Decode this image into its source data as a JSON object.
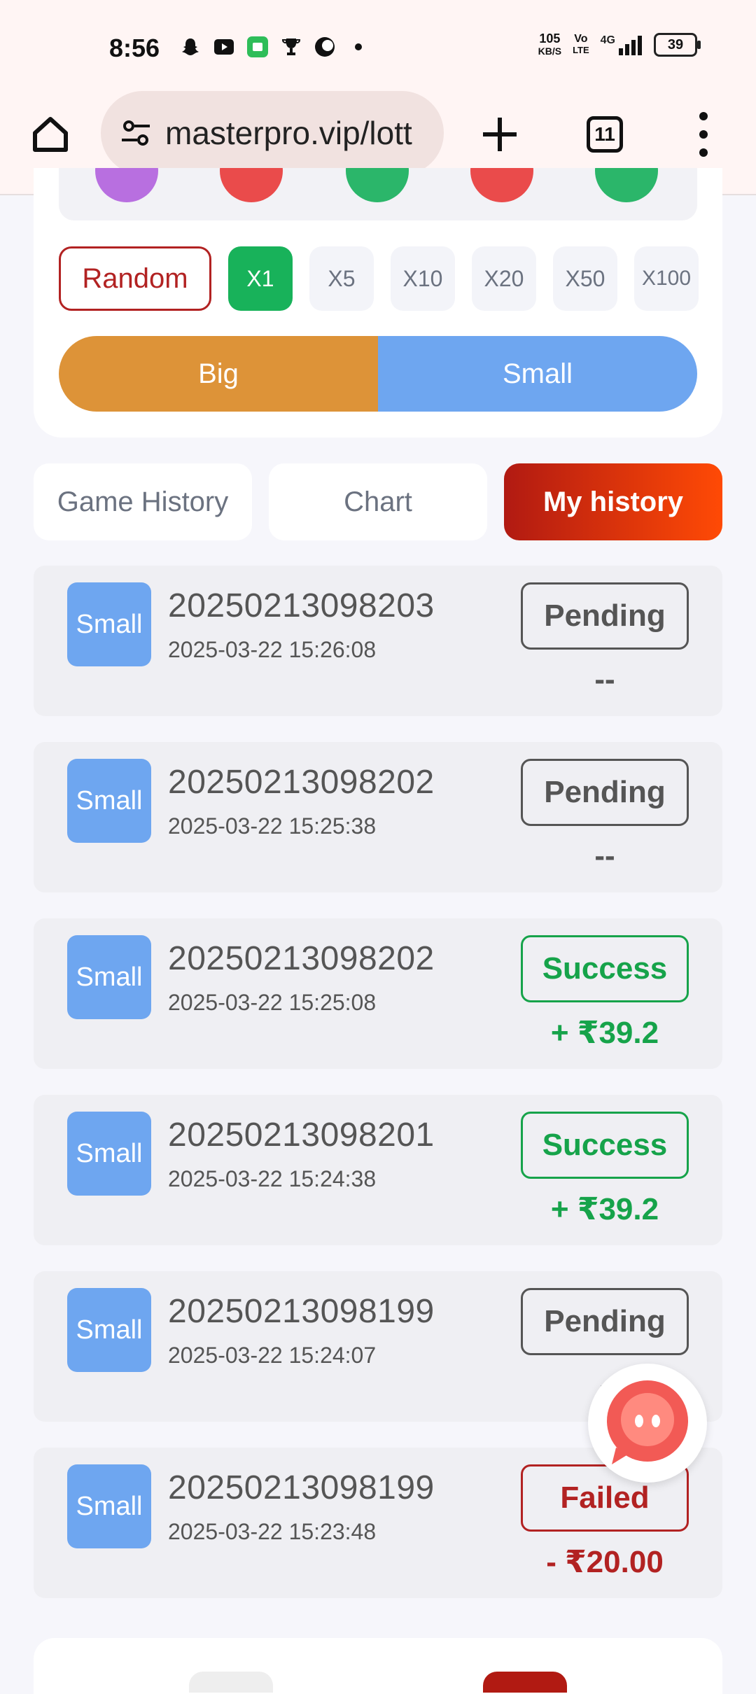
{
  "status_bar": {
    "time": "8:56",
    "net_speed_value": "105",
    "net_speed_unit": "KB/S",
    "volte_top": "Vo",
    "volte_bottom": "LTE",
    "network": "4G",
    "battery": "39"
  },
  "browser": {
    "url": "masterpro.vip/lott",
    "tab_count": "11"
  },
  "bet_panel": {
    "random_label": "Random",
    "multipliers": [
      "X1",
      "X5",
      "X10",
      "X20",
      "X50",
      "X100"
    ],
    "active_multiplier": "X1",
    "big_label": "Big",
    "small_label": "Small",
    "colors": {
      "big": "#dd9338",
      "small": "#6ea6f0",
      "active_mult": "#18b25a"
    }
  },
  "tabs": {
    "game_history": "Game History",
    "chart": "Chart",
    "my_history": "My history",
    "active": "My history"
  },
  "history": [
    {
      "bet": "Small",
      "period": "20250213098203",
      "time": "2025-03-22 15:26:08",
      "status": "Pending",
      "amount": "--"
    },
    {
      "bet": "Small",
      "period": "20250213098202",
      "time": "2025-03-22 15:25:38",
      "status": "Pending",
      "amount": "--"
    },
    {
      "bet": "Small",
      "period": "20250213098202",
      "time": "2025-03-22 15:25:08",
      "status": "Success",
      "amount": "+ ₹39.2"
    },
    {
      "bet": "Small",
      "period": "20250213098201",
      "time": "2025-03-22 15:24:38",
      "status": "Success",
      "amount": "+ ₹39.2"
    },
    {
      "bet": "Small",
      "period": "20250213098199",
      "time": "2025-03-22 15:24:07",
      "status": "Pending",
      "amount": "-"
    },
    {
      "bet": "Small",
      "period": "20250213098199",
      "time": "2025-03-22 15:23:48",
      "status": "Failed",
      "amount": "- ₹20.00"
    }
  ]
}
